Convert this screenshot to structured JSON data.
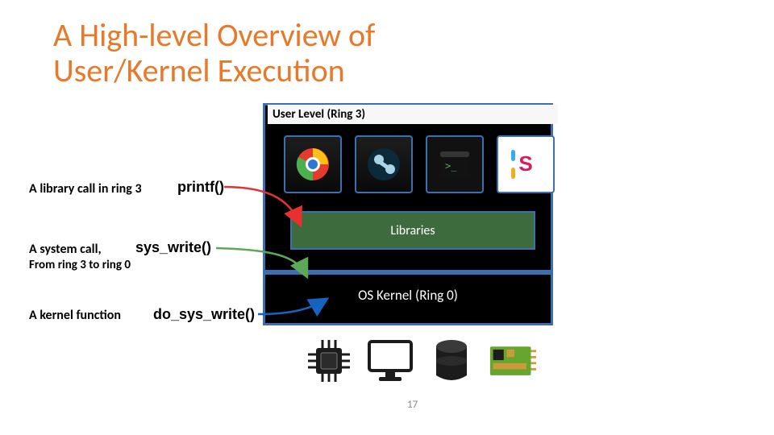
{
  "title_line1": "A High-level Overview of",
  "title_line2": "User/Kernel Execution",
  "panels": {
    "user_label": "User Level (Ring 3)",
    "libraries_label": "Libraries",
    "kernel_label": "OS Kernel (Ring 0)"
  },
  "annotations": {
    "lib_call_desc": "A library call in ring 3",
    "lib_call_code": "printf()",
    "sys_call_desc": "A system call,",
    "sys_call_sub": "From ring 3 to ring 0",
    "sys_call_code": "sys_write()",
    "kernel_fn_desc": "A kernel function",
    "kernel_fn_code": "do_sys_write()"
  },
  "apps": [
    {
      "name": "chrome-icon"
    },
    {
      "name": "store-icon"
    },
    {
      "name": "terminal-icon"
    },
    {
      "name": "slack-icon"
    }
  ],
  "hardware": [
    {
      "name": "cpu-icon"
    },
    {
      "name": "monitor-icon"
    },
    {
      "name": "hard-disk-icon"
    },
    {
      "name": "board-icon"
    }
  ],
  "page_number": "17",
  "colors": {
    "accent": "#E8792A",
    "border": "#3A6FB0",
    "libraries_bg": "#3E6B3E",
    "arrow_red": "#E73131",
    "arrow_green": "#5DA858",
    "arrow_blue": "#1565C0",
    "card_green": "#66A62F"
  }
}
